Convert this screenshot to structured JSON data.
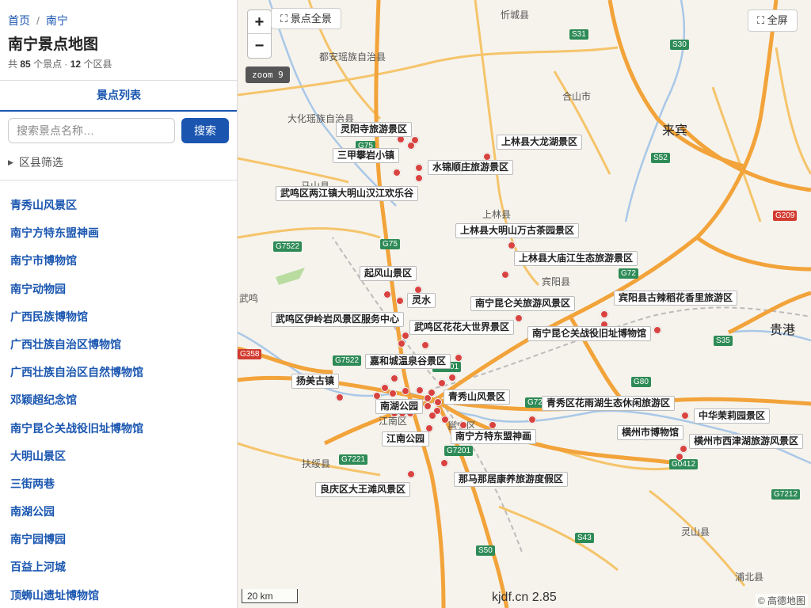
{
  "sidebar": {
    "breadcrumb": {
      "home": "首页",
      "separator": "/",
      "city": "南宁"
    },
    "title": "南宁景点地图",
    "summary": {
      "prefix": "共",
      "spots": "85",
      "spots_suffix": "个景点 ·",
      "districts": "12",
      "districts_suffix": "个区县"
    },
    "tab_label": "景点列表",
    "search": {
      "placeholder": "搜索景点名称…",
      "button": "搜索"
    },
    "filter_label": "区县筛选",
    "items": [
      "青秀山风景区",
      "南宁方特东盟神画",
      "南宁市博物馆",
      "南宁动物园",
      "广西民族博物馆",
      "广西壮族自治区博物馆",
      "广西壮族自治区自然博物馆",
      "邓颖超纪念馆",
      "南宁昆仑关战役旧址博物馆",
      "大明山景区",
      "三街两巷",
      "南湖公园",
      "南宁园博园",
      "百益上河城",
      "顶蛳山遗址博物馆"
    ]
  },
  "map": {
    "zoom_in": "+",
    "zoom_out": "−",
    "full_view_button": "⛶ 景点全景",
    "fullscreen_button": "⛶ 全屏",
    "zoom_level": "zoom 9",
    "scale": "20 km",
    "credit": "kjdf.cn 2.85",
    "attribution": "© 高德地图",
    "colors": {
      "marker": "#d9433f",
      "accent": "#1a56b0",
      "highway": "#f2a33a",
      "road": "#f5c46b"
    },
    "spot_labels": [
      "灵阳寺旅游景区",
      "上林县大龙湖景区",
      "三甲攀岩小镇",
      "水锦顺庄旅游景区",
      "武鸣区两江镇大明山汉江欢乐谷",
      "上林县大明山万古茶园景区",
      "上林县大庙江生态旅游景区",
      "起风山景区",
      "灵水",
      "南宁昆仑关旅游风景区",
      "宾阳县古辣稻花香里旅游区",
      "武鸣区伊岭岩风景区服务中心",
      "武鸣区花花大世界景区",
      "南宁昆仑关战役旧址博物馆",
      "嘉和城温泉谷景区",
      "扬美古镇",
      "青秀山风景区",
      "青秀区花雨湖生态休闲旅游区",
      "中华茉莉园景区",
      "横州市博物馆",
      "横州市西津湖旅游风景区",
      "南湖公园",
      "江南公园",
      "南宁方特东盟神画",
      "那马那居康养旅游度假区",
      "良庆区大王滩风景区"
    ],
    "towns": [
      "都安瑶族自治县",
      "忻城县",
      "合山市",
      "大化瑶族自治县",
      "上林县",
      "宾阳县",
      "扶绥县",
      "灵山县",
      "浦北县",
      "武鸣",
      "江南区",
      "邕宁区",
      "马山县"
    ],
    "cities": [
      "来宾",
      "贵港"
    ],
    "road_shields": [
      "G75",
      "G7522",
      "S31",
      "S30",
      "S52",
      "G209",
      "G72",
      "S35",
      "G80",
      "G7201",
      "G7221",
      "S50",
      "S43",
      "G7212",
      "G0412",
      "G358",
      "G72"
    ]
  }
}
